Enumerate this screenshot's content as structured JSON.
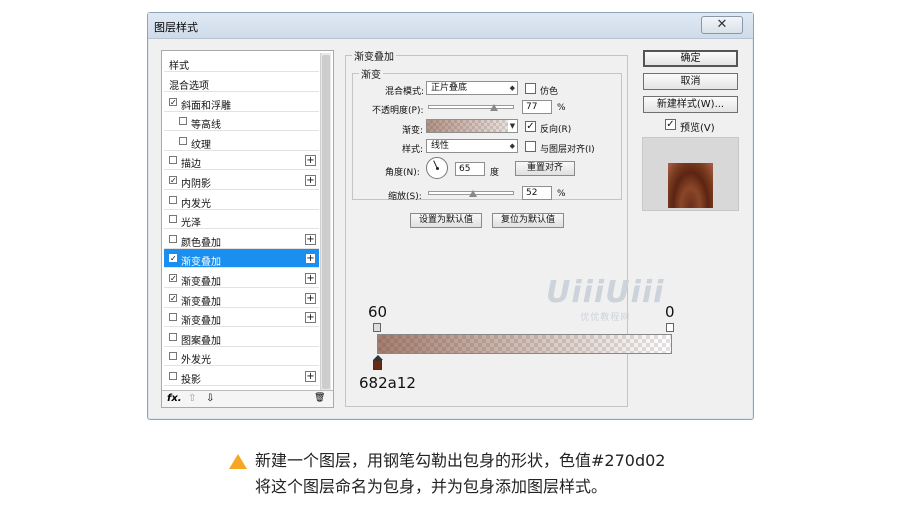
{
  "window": {
    "title": "图层样式",
    "close_glyph": "✕"
  },
  "left_panel": {
    "header": "样式",
    "items": [
      {
        "label": "混合选项",
        "checkbox": false,
        "checked": false,
        "plus": false,
        "selected": false
      },
      {
        "label": "斜面和浮雕",
        "checkbox": true,
        "checked": true,
        "plus": false,
        "selected": false
      },
      {
        "label": "等高线",
        "checkbox": true,
        "checked": false,
        "plus": false,
        "selected": false
      },
      {
        "label": "纹理",
        "checkbox": true,
        "checked": false,
        "plus": false,
        "selected": false
      },
      {
        "label": "描边",
        "checkbox": true,
        "checked": false,
        "plus": true,
        "selected": false
      },
      {
        "label": "内阴影",
        "checkbox": true,
        "checked": true,
        "plus": true,
        "selected": false
      },
      {
        "label": "内发光",
        "checkbox": true,
        "checked": false,
        "plus": false,
        "selected": false
      },
      {
        "label": "光泽",
        "checkbox": true,
        "checked": false,
        "plus": false,
        "selected": false
      },
      {
        "label": "颜色叠加",
        "checkbox": true,
        "checked": false,
        "plus": true,
        "selected": false
      },
      {
        "label": "渐变叠加",
        "checkbox": true,
        "checked": true,
        "plus": true,
        "selected": true
      },
      {
        "label": "渐变叠加",
        "checkbox": true,
        "checked": true,
        "plus": true,
        "selected": false
      },
      {
        "label": "渐变叠加",
        "checkbox": true,
        "checked": true,
        "plus": true,
        "selected": false
      },
      {
        "label": "渐变叠加",
        "checkbox": true,
        "checked": false,
        "plus": true,
        "selected": false
      },
      {
        "label": "图案叠加",
        "checkbox": true,
        "checked": false,
        "plus": false,
        "selected": false
      },
      {
        "label": "外发光",
        "checkbox": true,
        "checked": false,
        "plus": false,
        "selected": false
      },
      {
        "label": "投影",
        "checkbox": true,
        "checked": false,
        "plus": true,
        "selected": false
      }
    ],
    "footer": {
      "fx": "fx.",
      "up": "⇧",
      "down": "⇩",
      "trash": "🗑"
    }
  },
  "gradient_overlay": {
    "group_title": "渐变叠加",
    "sub_title": "渐变",
    "blend_mode_label": "混合模式:",
    "blend_mode_value": "正片叠底",
    "dither_label": "仿色",
    "opacity_label": "不透明度(P):",
    "opacity_value": "77",
    "opacity_level": 0.77,
    "gradient_label": "渐变:",
    "reverse_label": "反向(R)",
    "style_label": "样式:",
    "style_value": "线性",
    "align_label": "与图层对齐(I)",
    "angle_label": "角度(N):",
    "angle_value": "65",
    "angle_unit": "度",
    "reset_align_button": "重置对齐",
    "scale_label": "缩放(S):",
    "scale_value": "52",
    "scale_level": 0.52,
    "percent": "%",
    "set_default_button": "设置为默认值",
    "reset_default_button": "复位为默认值"
  },
  "right_buttons": {
    "ok": "确定",
    "cancel": "取消",
    "new_style": "新建样式(W)...",
    "preview_label": "预览(V)",
    "preview_checked": true
  },
  "gradient_editor": {
    "left_opacity": "60",
    "right_opacity": "0",
    "color_stop_hex": "682a12",
    "stop_color": "#682a12"
  },
  "watermark": {
    "logo": "UiiiUiii",
    "text": "优优教程网"
  },
  "caption": {
    "line1": "新建一个图层，用钢笔勾勒出包身的形状，色值#270d02",
    "line2": "将这个图层命名为包身，并为包身添加图层样式。"
  }
}
